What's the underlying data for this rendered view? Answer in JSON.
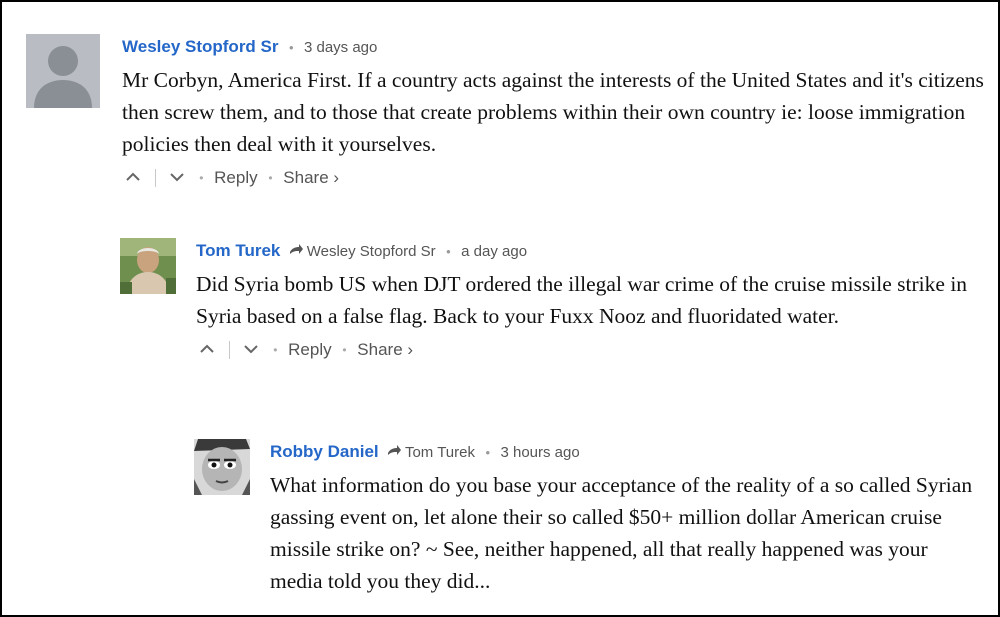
{
  "comments": [
    {
      "author": "Wesley Stopford Sr",
      "reply_to": "",
      "time": "3 days ago",
      "text": "Mr Corbyn, America First. If a country acts against the interests of the United States and it's citizens then screw them, and to those that create problems within their own country ie: loose immigration policies then deal with it yourselves.",
      "reply_label": "Reply",
      "share_label": "Share ›"
    },
    {
      "author": "Tom Turek",
      "reply_to": "Wesley Stopford Sr",
      "time": "a day ago",
      "text": "Did Syria bomb US when DJT ordered the illegal war crime of the cruise missile strike in Syria based on a false flag. Back to your Fuxx Nooz and fluoridated water.",
      "reply_label": "Reply",
      "share_label": "Share ›"
    },
    {
      "author": "Robby Daniel",
      "reply_to": "Tom Turek",
      "time": "3 hours ago",
      "text": "What information do you base your acceptance of the reality of a so called Syrian gassing event on, let alone their so called $50+ million dollar American cruise missile strike on? ~ See, neither happened, all that really happened was your media told you they did..."
    }
  ],
  "icons": {
    "upvote": "chevron-up-icon",
    "downvote": "chevron-down-icon",
    "reply_arrow": "reply-arrow-icon"
  },
  "colors": {
    "author_link": "#2467c8",
    "meta_text": "#555555",
    "body_text": "#111111"
  }
}
